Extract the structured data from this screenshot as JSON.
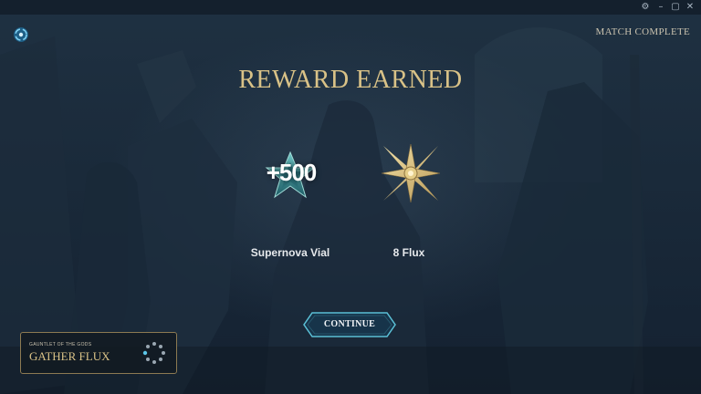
{
  "window": {
    "controls": [
      {
        "name": "settings",
        "glyph": "⚙"
      },
      {
        "name": "minimize",
        "glyph": "–"
      },
      {
        "name": "maximize",
        "glyph": "▢"
      },
      {
        "name": "close",
        "glyph": "✕"
      }
    ]
  },
  "status": "MATCH COMPLETE",
  "heading": "REWARD EARNED",
  "rewards": [
    {
      "amount": "+500",
      "label": "Supernova Vial",
      "icon": "star-icon"
    },
    {
      "label": "8 Flux",
      "icon": "flux-icon"
    }
  ],
  "continue_label": "CONTINUE",
  "mode": {
    "subtitle": "GAUNTLET OF THE GODS",
    "title": "GATHER FLUX"
  },
  "colors": {
    "gold": "#d9c287",
    "teal": "#4aa3a8",
    "background": "#172434"
  }
}
